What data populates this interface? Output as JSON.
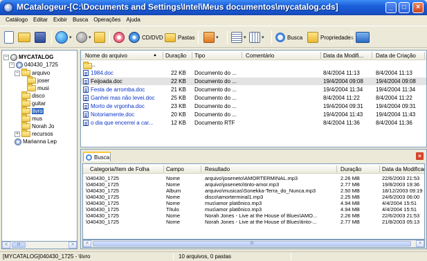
{
  "window": {
    "title": "MCatalogeur-[C:\\Documents and Settings\\Intel\\Meus documentos\\mycatalog.cds]",
    "min_label": "_",
    "max_label": "□",
    "close_label": "×"
  },
  "menu": [
    "Catálogo",
    "Editar",
    "Exibir",
    "Busca",
    "Operações",
    "Ajuda"
  ],
  "toolbar": {
    "cd_label": "CD/DVD",
    "pastas_label": "Pastas",
    "busca_label": "Busca",
    "propriedades_label": "Propriedades"
  },
  "tree": {
    "root": "MYCATALOG",
    "disc": "040430_1725",
    "items": [
      "arquivo",
      "joser",
      "musi",
      "disco",
      "guitar",
      "livro",
      "mus",
      "Norah Jo",
      "recursos",
      "Marianna Lep"
    ],
    "selected": "livro",
    "collapse_sign": "−",
    "expand_sign": "+"
  },
  "filelist": {
    "columns": [
      "Nome do arquivo",
      "Duração",
      "Tipo",
      "Comentário",
      "Data da Modifi...",
      "Data de Criação"
    ],
    "parent_label": "..",
    "rows": [
      {
        "name": "1984.doc",
        "size": "22 KB",
        "type": "Documento do ...",
        "comment": "",
        "modified": "8/4/2004 11:13",
        "created": "8/4/2004 11:13"
      },
      {
        "name": "Feijoada.doc",
        "size": "22 KB",
        "type": "Documento do ...",
        "comment": "",
        "modified": "19/4/2004 09:08",
        "created": "19/4/2004 09:08"
      },
      {
        "name": "Festa de arromba.doc",
        "size": "21 KB",
        "type": "Documento do ...",
        "comment": "",
        "modified": "19/4/2004 11:34",
        "created": "19/4/2004 11:34"
      },
      {
        "name": "Ganhei mas não levei.doc",
        "size": "25 KB",
        "type": "Documento do ...",
        "comment": "",
        "modified": "8/4/2004 11:22",
        "created": "8/4/2004 11:22"
      },
      {
        "name": "Morto de vrgonha.doc",
        "size": "23 KB",
        "type": "Documento do ...",
        "comment": "",
        "modified": "19/4/2004 09:31",
        "created": "19/4/2004 09:31"
      },
      {
        "name": "Notoriamente.doc",
        "size": "20 KB",
        "type": "Documento do ...",
        "comment": "",
        "modified": "19/4/2004 11:43",
        "created": "19/4/2004 11:43"
      },
      {
        "name": "o dia que encerrei a car...",
        "size": "12 KB",
        "type": "Documento RTF",
        "comment": "",
        "modified": "8/4/2004 11:36",
        "created": "8/4/2004 11:36"
      }
    ]
  },
  "search": {
    "tab_label": "Busca",
    "close_label": "×",
    "columns": [
      "Categoria/Item de Folha",
      "Campo",
      "Resultado",
      "Duração",
      "Data da Modificaç"
    ],
    "rows": [
      {
        "category": "\\040430_1725",
        "field": "Nome",
        "result": "arquivo\\joseneto\\AMORTERMINAL.mp3",
        "size": "2.26 MB",
        "date": "22/6/2003 21:53"
      },
      {
        "category": "\\040430_1725",
        "field": "Nome",
        "result": "arquivo\\joseneto\\tinto-amor.mp3",
        "size": "2.77 MB",
        "date": "19/8/2003 19:36"
      },
      {
        "category": "\\040430_1725",
        "field": "Album",
        "result": "arquivo\\musicas\\Sonekka-Terra_do_Nunca.mp3",
        "size": "2.50 MB",
        "date": "18/12/2003 09:19"
      },
      {
        "category": "\\040430_1725",
        "field": "Nome",
        "result": "disco\\amorterminal1.mp3",
        "size": "2.25 MB",
        "date": "24/6/2003 06:00"
      },
      {
        "category": "\\040430_1725",
        "field": "Nome",
        "result": "mus\\amor platônico.mp3",
        "size": "4.94 MB",
        "date": "4/4/2004 15:51"
      },
      {
        "category": "\\040430_1725",
        "field": "Título",
        "result": "mus\\amor platônico.mp3",
        "size": "4.94 MB",
        "date": "4/4/2004 15:51"
      },
      {
        "category": "\\040430_1725",
        "field": "Nome",
        "result": "Norah Jones - Live at the House of Blues\\AMO...",
        "size": "2.26 MB",
        "date": "22/6/2003 21:53"
      },
      {
        "category": "\\040430_1725",
        "field": "Nome",
        "result": "Norah Jones - Live at the House of Blues\\tinto-...",
        "size": "2.77 MB",
        "date": "21/8/2003 05:13"
      }
    ]
  },
  "status": {
    "path": "[MYCATALOG]040430_1725 - \\livro",
    "count": "10 arquivos, 0 pastas"
  },
  "scroll": {
    "left": "<",
    "right": ">",
    "grip": "III"
  }
}
